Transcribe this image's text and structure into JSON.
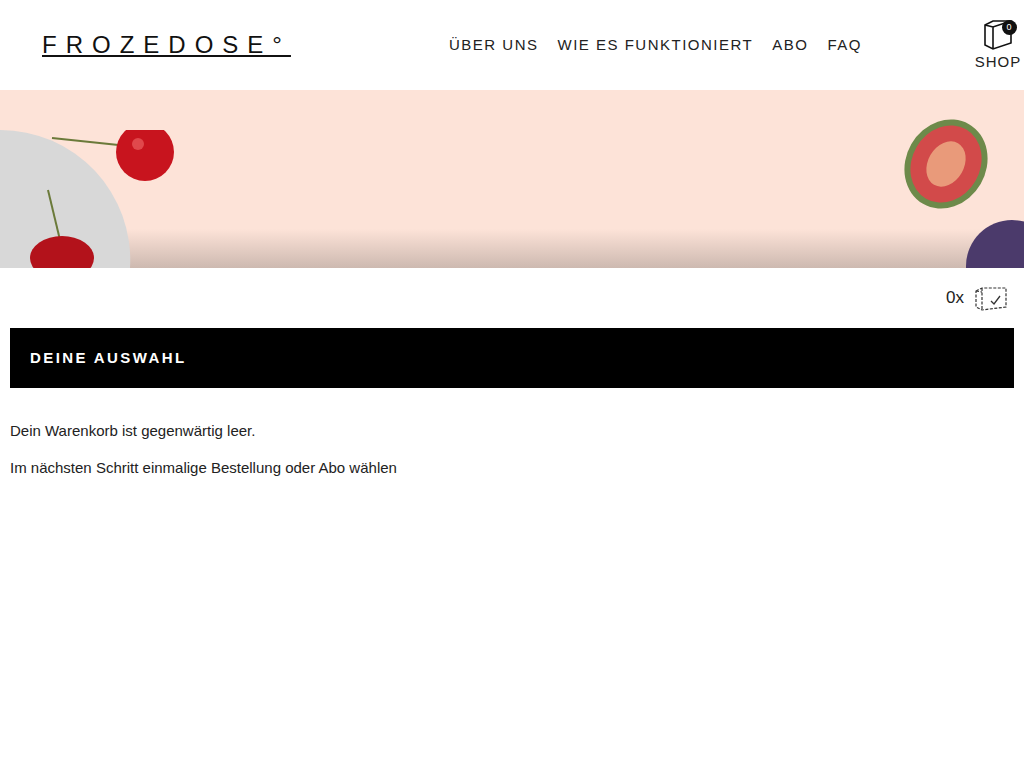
{
  "header": {
    "logo": "FROZEDOSE°",
    "nav": [
      "ÜBER UNS",
      "WIE ES FUNKTIONIERT",
      "ABO",
      "FAQ"
    ],
    "cart": {
      "badge": "0",
      "label": "SHOP"
    }
  },
  "counter": "0x",
  "selection": {
    "title": "DEINE AUSWAHL",
    "empty_message": "Dein Warenkorb ist gegenwärtig leer.",
    "next_step": "Im nächsten Schritt einmalige Bestellung oder Abo wählen"
  }
}
